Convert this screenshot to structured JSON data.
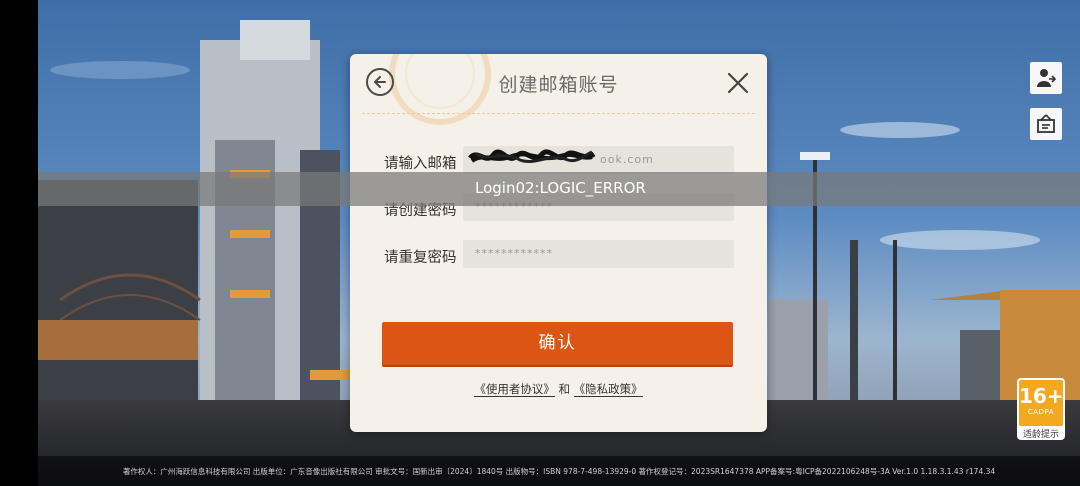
{
  "dialog": {
    "title": "创建邮箱账号",
    "email_label": "请输入邮箱",
    "email_value": "ook.com",
    "password_label": "请创建密码",
    "password_value": "************",
    "repeat_label": "请重复密码",
    "repeat_value": "************",
    "confirm_label": "确认",
    "user_agreement": "《使用者协议》",
    "and_text": "和",
    "privacy_policy": "《隐私政策》"
  },
  "toast": {
    "message": "Login02:LOGIC_ERROR"
  },
  "age_rating": {
    "number": "16+",
    "org": "CADPA",
    "label": "适龄提示"
  },
  "footer": {
    "text": "著作权人：广州海跃信息科技有限公司 出版单位：广东音像出版社有限公司 审批文号：国新出审〔2024〕1840号 出版物号：ISBN 978-7-498-13929-0 著作权登记号：2023SR1647378 APP备案号:粤ICP备2022106248号-3A Ver.1.0 1.18.3.1.43 r174.34"
  },
  "icons": {
    "back": "back-arrow-icon",
    "close": "close-icon",
    "account": "account-switch-icon",
    "notice": "notice-board-icon"
  },
  "colors": {
    "accent": "#dd5514",
    "dialog_bg": "#f5f0e8",
    "badge": "#f2a81f"
  }
}
